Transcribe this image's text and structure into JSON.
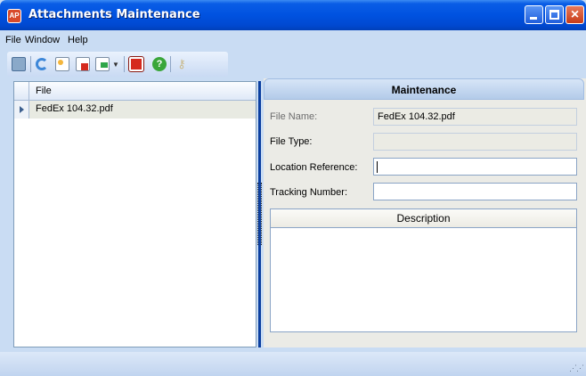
{
  "window": {
    "title": "Attachments Maintenance",
    "app_icon": "AP"
  },
  "menu": {
    "items": [
      "File",
      "Window",
      "Help"
    ]
  },
  "toolbar": {
    "icons": [
      "save-icon",
      "refresh-icon",
      "new-icon",
      "delete-icon",
      "export-icon",
      "dropdown-arrow",
      "stop-icon",
      "help-icon",
      "key-icon"
    ]
  },
  "grid": {
    "column_header": "File",
    "rows": [
      {
        "file": "FedEx 104.32.pdf"
      }
    ]
  },
  "maintenance": {
    "title": "Maintenance",
    "file_name_label": "File Name:",
    "file_name_value": "FedEx 104.32.pdf",
    "file_type_label": "File Type:",
    "file_type_value": "",
    "location_label": "Location Reference:",
    "location_value": "",
    "tracking_label": "Tracking Number:",
    "tracking_value": "",
    "description_header": "Description",
    "description_value": ""
  },
  "colors": {
    "titlebar": "#0052e0",
    "window_bg": "#c9dcf3",
    "selected_row": "#e8eae2"
  }
}
